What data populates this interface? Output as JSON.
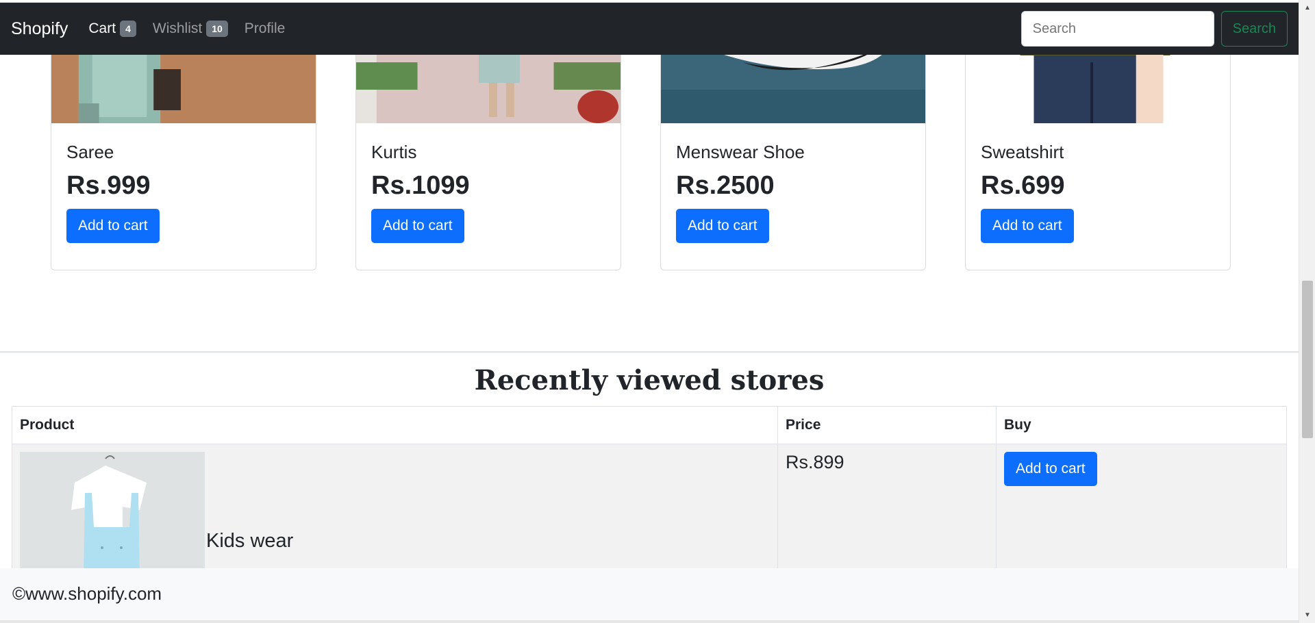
{
  "navbar": {
    "brand": "Shopify",
    "cart_label": "Cart",
    "cart_count": "4",
    "wishlist_label": "Wishlist",
    "wishlist_count": "10",
    "profile_label": "Profile",
    "search_placeholder": "Search",
    "search_button": "Search"
  },
  "products": [
    {
      "name": "Saree",
      "price": "Rs.999",
      "button": "Add to cart"
    },
    {
      "name": "Kurtis",
      "price": "Rs.1099",
      "button": "Add to cart"
    },
    {
      "name": "Menswear Shoe",
      "price": "Rs.2500",
      "button": "Add to cart"
    },
    {
      "name": "Sweatshirt",
      "price": "Rs.699",
      "button": "Add to cart"
    }
  ],
  "recent": {
    "title": "Recently viewed stores",
    "headers": [
      "Product",
      "Price",
      "Buy"
    ],
    "rows": [
      {
        "product": "Kids wear",
        "price": "Rs.899",
        "button": "Add to cart"
      }
    ]
  },
  "footer": {
    "text": "©www.shopify.com"
  },
  "colors": {
    "navbar": "#212529",
    "primary": "#0d6efd",
    "success": "#198754"
  }
}
